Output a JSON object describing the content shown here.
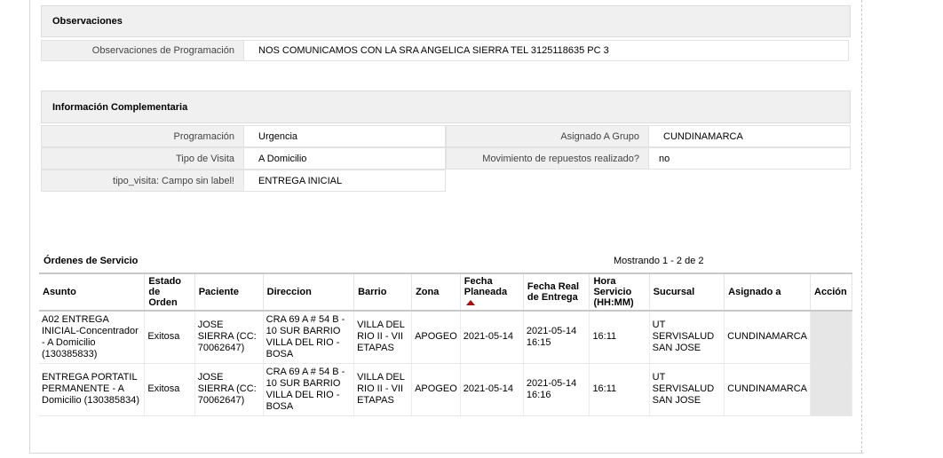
{
  "observaciones": {
    "header": "Observaciones",
    "label": "Observaciones de Programación",
    "value": "NOS COMUNICAMOS CON LA SRA ANGELICA SIERRA TEL 3125118635 PC 3"
  },
  "info": {
    "header": "Información Complementaria",
    "programacion_label": "Programación",
    "programacion_value": "Urgencia",
    "asignado_label": "Asignado A Grupo",
    "asignado_value": "CUNDINAMARCA",
    "tipo_visita_label": "Tipo de Visita",
    "tipo_visita_value": "A Domicilio",
    "movimiento_label": "Movimiento de repuestos realizado?",
    "movimiento_value": "no",
    "campo_label": "tipo_visita: Campo sin label!",
    "campo_value": "ENTREGA INICIAL"
  },
  "ordenes": {
    "title": "Órdenes de Servicio",
    "showing": "Mostrando 1 - 2 de 2",
    "columns": [
      "Asunto",
      "Estado de Orden",
      "Paciente",
      "Direccion",
      "Barrio",
      "Zona",
      "Fecha Planeada",
      "Fecha Real de Entrega",
      "Hora Servicio (HH:MM)",
      "Sucursal",
      "Asignado a",
      "Acción"
    ],
    "rows": [
      {
        "asunto": "A02 ENTREGA INICIAL-Concentrador - A Domicilio (130385833)",
        "estado": "Exitosa",
        "paciente": "JOSE SIERRA (CC: 70062647)",
        "direccion": "CRA 69 A # 54 B - 10 SUR BARRIO VILLA DEL RIO - BOSA",
        "barrio": "VILLA DEL RIO II - VII ETAPAS",
        "zona": "APOGEO",
        "fecha_planeada": "2021-05-14",
        "fecha_real": "2021-05-14 16:15",
        "hora": "16:11",
        "sucursal": "UT SERVISALUD SAN JOSE",
        "asignado": "CUNDINAMARCA",
        "accion": ""
      },
      {
        "asunto": "ENTREGA PORTATIL PERMANENTE - A Domicilio (130385834)",
        "estado": "Exitosa",
        "paciente": "JOSE SIERRA (CC: 70062647)",
        "direccion": "CRA 69 A # 54 B - 10 SUR BARRIO VILLA DEL RIO - BOSA",
        "barrio": "VILLA DEL RIO II - VII ETAPAS",
        "zona": "APOGEO",
        "fecha_planeada": "2021-05-14",
        "fecha_real": "2021-05-14 16:16",
        "hora": "16:11",
        "sucursal": "UT SERVISALUD SAN JOSE",
        "asignado": "CUNDINAMARCA",
        "accion": ""
      }
    ]
  }
}
